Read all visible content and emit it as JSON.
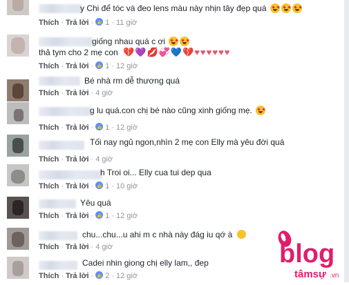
{
  "actions": {
    "like": "Thích",
    "reply": "Trả lời"
  },
  "comments": [
    {
      "text": "y Chi để tóc và đeo lens màu này nhịn tây đẹp quá",
      "likes": "1",
      "time": "11 giờ"
    },
    {
      "text": "giống nhau quá c ơi",
      "text2": "thả tym cho 2 mẹ con",
      "likes": "1",
      "time": "12 giờ"
    },
    {
      "text": "Bé nhà rm dễ thương quá",
      "likes": "",
      "time": "4 giờ"
    },
    {
      "text": "g lu quá.con chị bé nào cũng xinh giống mẹ.",
      "likes": "1",
      "time": "12 giờ"
    },
    {
      "text": "Tối nay ngủ ngon,nhìn 2 mẹ con Elly mà yêu đời quá",
      "likes": "",
      "time": "4 giờ"
    },
    {
      "text": "h Troi oi... Elly cua tui dep qua",
      "likes": "1",
      "time": "10 giờ"
    },
    {
      "text": "Yêu quá",
      "likes": "1",
      "time": "12 giờ"
    },
    {
      "text": "chu...chu...u ahi m c nhà này đág iu qớ à",
      "likes": "",
      "time": "4 giờ"
    },
    {
      "text": "Cadei nhin giong chị elly lam,, đep",
      "likes": "2",
      "time": "12 giờ"
    }
  ],
  "logo": {
    "brand": "blog",
    "sub": "tâmsự",
    "tld": ".vn"
  },
  "colors": {
    "link": "#4b4f56",
    "meta": "#90949c",
    "like_badge": "#5890ff",
    "logo": "#e01e6b"
  }
}
